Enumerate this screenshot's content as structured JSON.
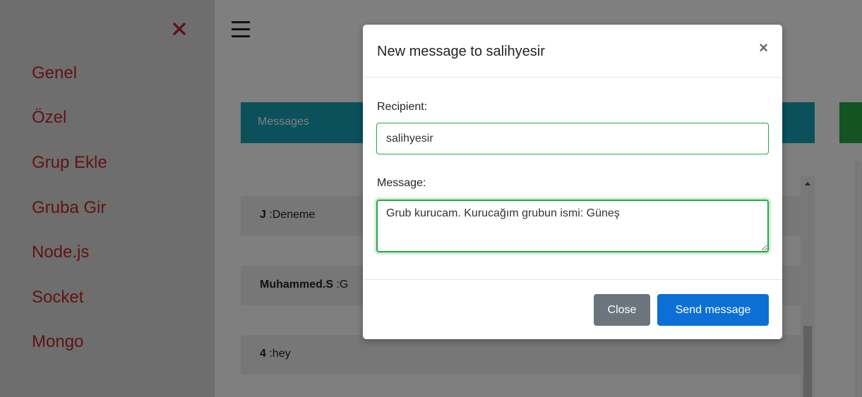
{
  "sidebar": {
    "close_icon": "close-icon",
    "close_color": "#c0282d",
    "items": [
      {
        "label": "Genel"
      },
      {
        "label": "Özel"
      },
      {
        "label": "Grup Ekle"
      },
      {
        "label": "Gruba Gir"
      },
      {
        "label": "Node.js"
      },
      {
        "label": "Socket"
      },
      {
        "label": "Mongo"
      }
    ]
  },
  "main": {
    "menu_icon": "hamburger-icon",
    "messages_header": "Messages",
    "messages": [
      {
        "user": "J",
        "text": " :Deneme"
      },
      {
        "user": "Muhammed.S",
        "text": " :G"
      },
      {
        "user": "4",
        "text": " :hey"
      }
    ]
  },
  "modal": {
    "title": "New message to salihyesir",
    "close_x": "×",
    "recipient_label": "Recipient:",
    "recipient_value": "salihyesir",
    "message_label": "Message:",
    "message_value": "Grub kurucam. Kurucağım grubun ismi: Güneş",
    "close_button": "Close",
    "send_button": "Send message"
  },
  "colors": {
    "messages_header": "#17a2b8",
    "success": "#28a745",
    "primary": "#0b6fd6",
    "secondary": "#6c757d",
    "sidebar_link": "#c0282d"
  }
}
